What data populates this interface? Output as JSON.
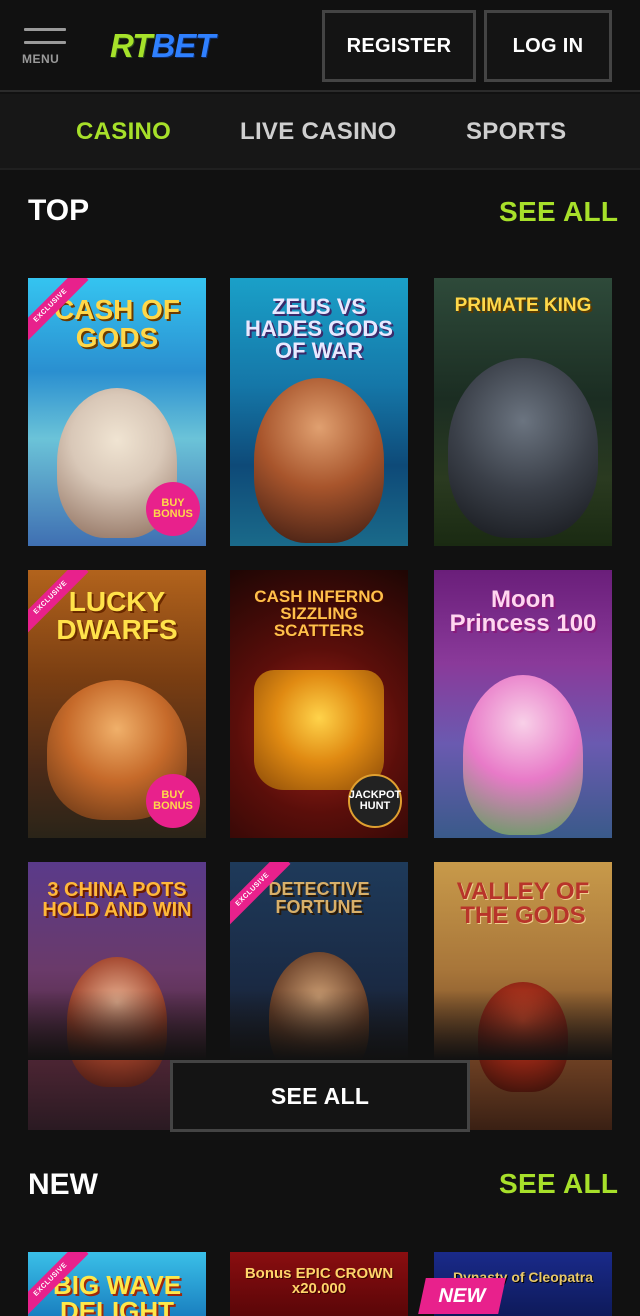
{
  "header": {
    "menu_label": "MENU",
    "logo_rt": "RT",
    "logo_bet": "BET",
    "register_label": "REGISTER",
    "login_label": "LOG IN"
  },
  "nav": {
    "items": [
      {
        "label": "CASINO",
        "active": true
      },
      {
        "label": "LIVE CASINO",
        "active": false
      },
      {
        "label": "SPORTS",
        "active": false
      }
    ]
  },
  "colors": {
    "accent": "#a7e02a",
    "background": "#111111",
    "exclusive_ribbon": "#e8218c",
    "logo_blue": "#2f80ff"
  },
  "top": {
    "title": "TOP",
    "see_all_label": "SEE ALL",
    "see_all_button_label": "SEE ALL",
    "games": [
      {
        "name": "CASH OF GODS",
        "ribbon": "EXCLUSIVE",
        "badge": "BUY BONUS"
      },
      {
        "name": "ZEUS VS HADES GODS OF WAR",
        "ribbon": "",
        "badge": ""
      },
      {
        "name": "PRIMATE KING",
        "ribbon": "",
        "badge": ""
      },
      {
        "name": "LUCKY DWARFS",
        "ribbon": "EXCLUSIVE",
        "badge": "BUY BONUS"
      },
      {
        "name": "CASH INFERNO SIZZLING SCATTERS",
        "ribbon": "",
        "badge": "JACKPOT HUNT"
      },
      {
        "name": "Moon Princess 100",
        "ribbon": "",
        "badge": ""
      },
      {
        "name": "3 CHINA POTS HOLD AND WIN",
        "ribbon": "",
        "badge": ""
      },
      {
        "name": "DETECTIVE FORTUNE",
        "ribbon": "EXCLUSIVE",
        "badge": ""
      },
      {
        "name": "VALLEY OF THE GODS",
        "ribbon": "",
        "badge": ""
      }
    ]
  },
  "new": {
    "title": "NEW",
    "see_all_label": "SEE ALL",
    "new_flag": "NEW",
    "games": [
      {
        "name": "BIG WAVE DELIGHT",
        "ribbon": "EXCLUSIVE"
      },
      {
        "name": "Bonus EPIC CROWN x20.000",
        "ribbon": ""
      },
      {
        "name": "Dynasty of Cleopatra",
        "ribbon": ""
      }
    ]
  }
}
